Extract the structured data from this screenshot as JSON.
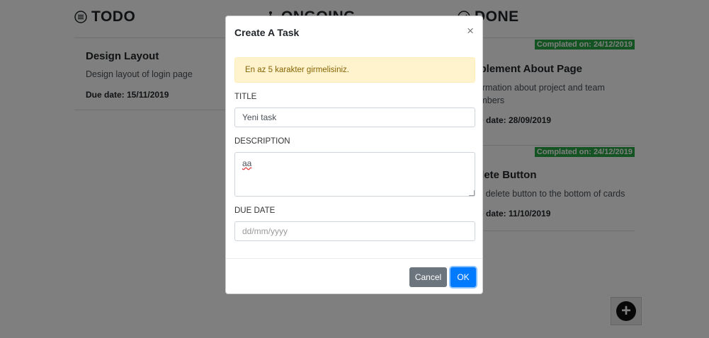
{
  "columns": {
    "todo": {
      "title": "TODO",
      "icon": "list-circle-icon"
    },
    "ongoing": {
      "title": "ONGOING",
      "icon": "walking-icon"
    },
    "done": {
      "title": "DONE",
      "icon": "check-circle-icon"
    }
  },
  "todo_cards": [
    {
      "title": "Design Layout",
      "description": "Design layout of login page",
      "due": "Due date: 15/11/2019"
    }
  ],
  "done_cards": [
    {
      "badge": "Complated on: 24/12/2019",
      "title": "Implement About Page",
      "description_line1": "Information about project and team",
      "description_line2": "members",
      "due": "Due date: 28/09/2019"
    },
    {
      "badge": "Complated on: 24/12/2019",
      "title": "Delete Button",
      "description_line1": "Add delete button to the bottom of cards",
      "due": "Due date: 11/10/2019"
    }
  ],
  "add_button": {
    "icon": "plus-circle-icon",
    "glyph": "+"
  },
  "modal": {
    "title": "Create A Task",
    "close_glyph": "×",
    "alert": "En az 5 karakter girmelisiniz.",
    "fields": {
      "title_label": "TITLE",
      "title_value": "Yeni task",
      "description_label": "DESCRIPTION",
      "description_value": "aa",
      "due_label": "DUE DATE",
      "due_placeholder": "dd/mm/yyyy"
    },
    "buttons": {
      "cancel": "Cancel",
      "ok": "OK"
    }
  },
  "colors": {
    "badge_green": "#28a745",
    "primary_blue": "#007bff",
    "secondary_gray": "#6c757d",
    "alert_bg": "#fff3cd",
    "alert_text": "#856404",
    "overlay": "rgba(0,0,0,0.5)"
  }
}
